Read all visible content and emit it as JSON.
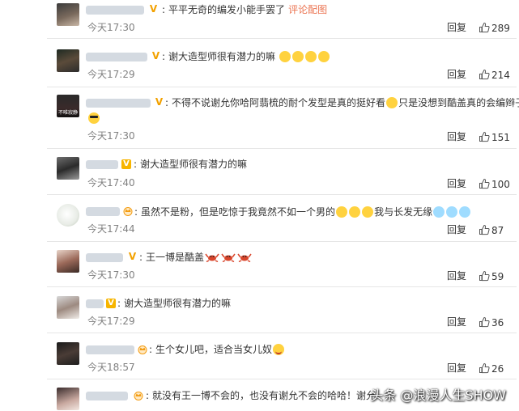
{
  "comments": [
    {
      "text": "平平无奇的编发小能手罢了",
      "link": "评论配图",
      "time": "今天17:30",
      "reply": "回复",
      "likes": "289"
    },
    {
      "text": "谢大造型师很有潜力的嘛",
      "time": "今天17:29",
      "reply": "回复",
      "likes": "214"
    },
    {
      "text": "不得不说谢允你哈阿翡梳的耐个发型是真的挺好看",
      "text2": "只是没想到酷盖真的会编辫子",
      "time": "今天17:30",
      "reply": "回复",
      "likes": "151"
    },
    {
      "text": "谢大造型师很有潜力的嘛",
      "time": "今天17:40",
      "reply": "回复",
      "likes": "100"
    },
    {
      "text": "虽然不是粉，但是吃惊于我竟然不如一个男的",
      "text2": "我与长发无缘",
      "time": "今天17:44",
      "reply": "回复",
      "likes": "87"
    },
    {
      "text": "王一博是酷盖",
      "time": "今天17:30",
      "reply": "回复",
      "likes": "59"
    },
    {
      "text": "谢大造型师很有潜力的嘛",
      "time": "今天17:29",
      "reply": "回复",
      "likes": "36"
    },
    {
      "text": "生个女儿吧，适合当女儿奴",
      "time": "今天18:57",
      "reply": "回复",
      "likes": "26"
    },
    {
      "text": "就没有王一博不会的，也没有谢允不会的哈哈！谢允"
    }
  ],
  "avatar_label_3": "不唯寂静",
  "watermark": "头条 @浪漫人生SHOW",
  "colors": {
    "username": "#eb7350",
    "meta": "#808080",
    "text": "#333333",
    "vip": "#f7b500"
  }
}
